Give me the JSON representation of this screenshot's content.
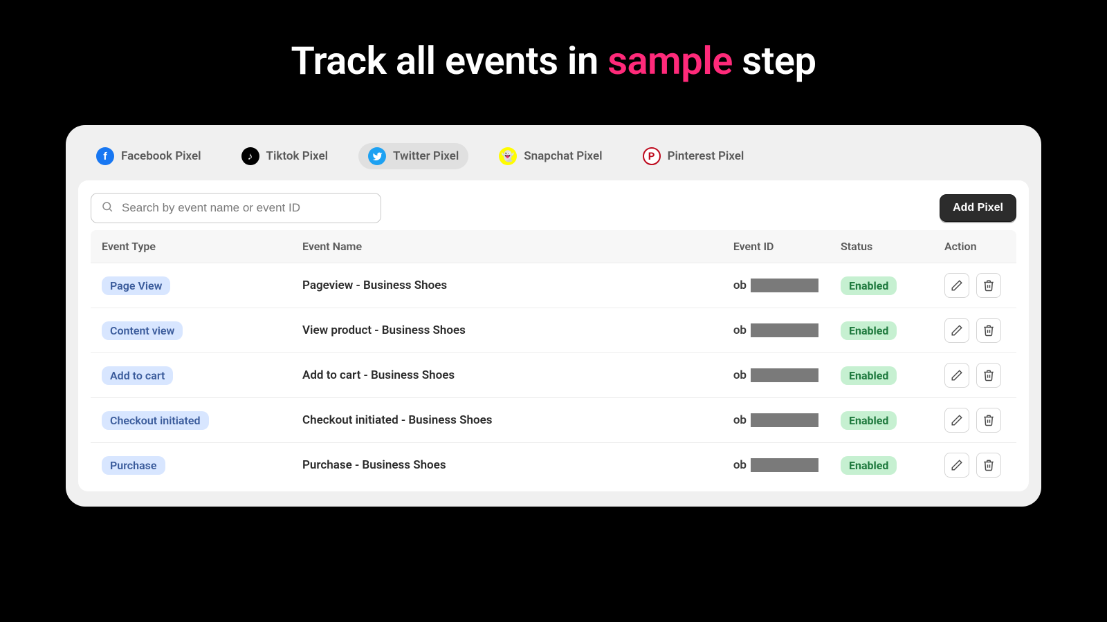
{
  "headline": {
    "pre": "Track all events in ",
    "accent": "sample",
    "post": " step"
  },
  "tabs": [
    {
      "id": "facebook",
      "label": "Facebook Pixel",
      "active": false
    },
    {
      "id": "tiktok",
      "label": "Tiktok Pixel",
      "active": false
    },
    {
      "id": "twitter",
      "label": "Twitter Pixel",
      "active": true
    },
    {
      "id": "snapchat",
      "label": "Snapchat Pixel",
      "active": false
    },
    {
      "id": "pinterest",
      "label": "Pinterest Pixel",
      "active": false
    }
  ],
  "search": {
    "placeholder": "Search by event name or event ID"
  },
  "buttons": {
    "add_pixel": "Add Pixel"
  },
  "columns": {
    "type": "Event Type",
    "name": "Event Name",
    "id": "Event ID",
    "status": "Status",
    "action": "Action"
  },
  "rows": [
    {
      "type": "Page View",
      "name": "Pageview - Business Shoes",
      "id_prefix": "ob",
      "status": "Enabled"
    },
    {
      "type": "Content view",
      "name": "View product - Business Shoes",
      "id_prefix": "ob",
      "status": "Enabled"
    },
    {
      "type": "Add to cart",
      "name": "Add to cart - Business Shoes",
      "id_prefix": "ob",
      "status": "Enabled"
    },
    {
      "type": "Checkout initiated",
      "name": "Checkout initiated - Business Shoes",
      "id_prefix": "ob",
      "status": "Enabled"
    },
    {
      "type": "Purchase",
      "name": "Purchase - Business Shoes",
      "id_prefix": "ob",
      "status": "Enabled"
    }
  ]
}
